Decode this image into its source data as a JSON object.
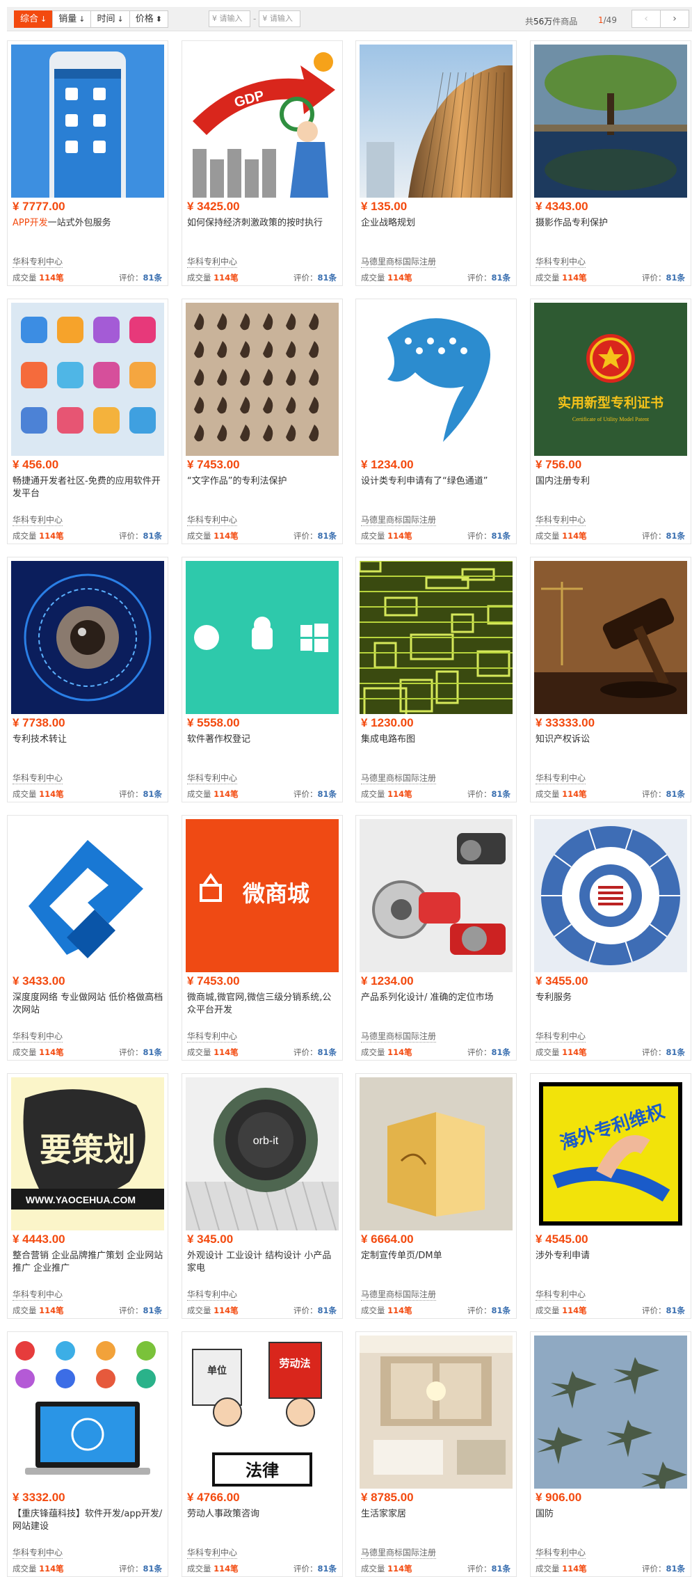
{
  "toolbar": {
    "sort": [
      {
        "label": "综合",
        "arrow": "↓",
        "active": true
      },
      {
        "label": "销量",
        "arrow": "↓",
        "active": false
      },
      {
        "label": "时间",
        "arrow": "↓",
        "active": false
      },
      {
        "label": "价格",
        "arrow": "⬍",
        "active": false
      }
    ],
    "price_min_placeholder": "¥ 请输入",
    "price_max_placeholder": "¥ 请输入",
    "price_dash": "-",
    "total_prefix": "共",
    "total_count": "56万",
    "total_suffix": "件商品",
    "page_current": "1",
    "page_total": "/49",
    "prev": "‹",
    "next": "›"
  },
  "products": [
    {
      "price": "¥ 7777.00",
      "title_hl": "APP开发",
      "title": "一站式外包服务",
      "shop": "华科专利中心",
      "sales_label": "成交量",
      "sales": "114笔",
      "reviews_label": "评价：",
      "reviews": "81条",
      "image": "app-phone"
    },
    {
      "price": "¥ 3425.00",
      "title_hl": "",
      "title": "如何保持经济刺激政策的按时执行",
      "shop": "华科专利中心",
      "sales_label": "成交量",
      "sales": "114笔",
      "reviews_label": "评价：",
      "reviews": "81条",
      "image": "gdp-cartoon"
    },
    {
      "price": "¥ 135.00",
      "title_hl": "",
      "title": "企业战略规划",
      "shop": "马德里商标国际注册",
      "sales_label": "成交量",
      "sales": "114笔",
      "reviews_label": "评价：",
      "reviews": "81条",
      "image": "building"
    },
    {
      "price": "¥ 4343.00",
      "title_hl": "",
      "title": "摄影作品专利保护",
      "shop": "华科专利中心",
      "sales_label": "成交量",
      "sales": "114笔",
      "reviews_label": "评价：",
      "reviews": "81条",
      "image": "tree"
    },
    {
      "price": "¥ 456.00",
      "title_hl": "",
      "title": "畅捷通开发者社区-免费的应用软件开发平台",
      "shop": "华科专利中心",
      "sales_label": "成交量",
      "sales": "114笔",
      "reviews_label": "评价：",
      "reviews": "81条",
      "image": "app-icons"
    },
    {
      "price": "¥ 7453.00",
      "title_hl": "",
      "title": "“文字作品”的专利法保护",
      "shop": "华科专利中心",
      "sales_label": "成交量",
      "sales": "114笔",
      "reviews_label": "评价：",
      "reviews": "81条",
      "image": "calligraphy"
    },
    {
      "price": "¥ 1234.00",
      "title_hl": "",
      "title": "设计类专利申请有了“绿色通道”",
      "shop": "马德里商标国际注册",
      "sales_label": "成交量",
      "sales": "114笔",
      "reviews_label": "评价：",
      "reviews": "81条",
      "image": "dolphin"
    },
    {
      "price": "¥ 756.00",
      "title_hl": "",
      "title": "国内注册专利",
      "shop": "华科专利中心",
      "sales_label": "成交量",
      "sales": "114笔",
      "reviews_label": "评价：",
      "reviews": "81条",
      "image": "certificate",
      "cert_title": "实用新型专利证书",
      "cert_sub": "Certificate of Utility Model Patent"
    },
    {
      "price": "¥ 7738.00",
      "title_hl": "",
      "title": "专利技术转让",
      "shop": "华科专利中心",
      "sales_label": "成交量",
      "sales": "114笔",
      "reviews_label": "评价：",
      "reviews": "81条",
      "image": "tech-eye"
    },
    {
      "price": "¥ 5558.00",
      "title_hl": "",
      "title": "软件著作权登记",
      "shop": "华科专利中心",
      "sales_label": "成交量",
      "sales": "114笔",
      "reviews_label": "评价：",
      "reviews": "81条",
      "image": "os-logos"
    },
    {
      "price": "¥ 1230.00",
      "title_hl": "",
      "title": "集成电路布图",
      "shop": "马德里商标国际注册",
      "sales_label": "成交量",
      "sales": "114笔",
      "reviews_label": "评价：",
      "reviews": "81条",
      "image": "circuit"
    },
    {
      "price": "¥ 33333.00",
      "title_hl": "",
      "title": "知识产权诉讼",
      "shop": "华科专利中心",
      "sales_label": "成交量",
      "sales": "114笔",
      "reviews_label": "评价：",
      "reviews": "81条",
      "image": "gavel"
    },
    {
      "price": "¥ 3433.00",
      "title_hl": "",
      "title": "深度度网络 专业做网站 低价格做高档次网站",
      "shop": "华科专利中心",
      "sales_label": "成交量",
      "sales": "114笔",
      "reviews_label": "评价：",
      "reviews": "81条",
      "image": "blue-logo"
    },
    {
      "price": "¥ 7453.00",
      "title_hl": "",
      "title": "微商城,微官网,微信三级分销系统,公众平台开发",
      "shop": "华科专利中心",
      "sales_label": "成交量",
      "sales": "114笔",
      "reviews_label": "评价：",
      "reviews": "81条",
      "image": "weishang",
      "weishang_text": "微商城"
    },
    {
      "price": "¥ 1234.00",
      "title_hl": "",
      "title": "产品系列化设计/ 准确的定位市场",
      "shop": "马德里商标国际注册",
      "sales_label": "成交量",
      "sales": "114笔",
      "reviews_label": "评价：",
      "reviews": "81条",
      "image": "tools"
    },
    {
      "price": "¥ 3455.00",
      "title_hl": "",
      "title": "专利服务",
      "shop": "华科专利中心",
      "sales_label": "成交量",
      "sales": "114笔",
      "reviews_label": "评价：",
      "reviews": "81条",
      "image": "circle-diagram"
    },
    {
      "price": "¥ 4443.00",
      "title_hl": "",
      "title": "整合营销 企业品牌推广策划 企业网站推广 企业推广",
      "shop": "华科专利中心",
      "sales_label": "成交量",
      "sales": "114笔",
      "reviews_label": "评价：",
      "reviews": "81条",
      "image": "yaocehua",
      "yaocehua_text": "WWW.YAOCEHUA.COM",
      "yaocehua_big": "要策划"
    },
    {
      "price": "¥ 345.00",
      "title_hl": "",
      "title": "外观设计 工业设计 结构设计 小产品家电",
      "shop": "华科专利中心",
      "sales_label": "成交量",
      "sales": "114笔",
      "reviews_label": "评价：",
      "reviews": "81条",
      "image": "orbit",
      "orbit_text": "orb-it"
    },
    {
      "price": "¥ 6664.00",
      "title_hl": "",
      "title": "定制宣传单页/DM单",
      "shop": "马德里商标国际注册",
      "sales_label": "成交量",
      "sales": "114笔",
      "reviews_label": "评价：",
      "reviews": "81条",
      "image": "brochure"
    },
    {
      "price": "¥ 4545.00",
      "title_hl": "",
      "title": "涉外专利申请",
      "shop": "华科专利中心",
      "sales_label": "成交量",
      "sales": "114笔",
      "reviews_label": "评价：",
      "reviews": "81条",
      "image": "overseas",
      "overseas_text": "海外专利维权"
    },
    {
      "price": "¥ 3332.00",
      "title_hl": "",
      "title": "【重庆锋蕴科技】软件开发/app开发/网站建设",
      "shop": "华科专利中心",
      "sales_label": "成交量",
      "sales": "114笔",
      "reviews_label": "评价：",
      "reviews": "81条",
      "image": "laptop-icons"
    },
    {
      "price": "¥ 4766.00",
      "title_hl": "",
      "title": "劳动人事政策咨询",
      "shop": "华科专利中心",
      "sales_label": "成交量",
      "sales": "114笔",
      "reviews_label": "评价：",
      "reviews": "81条",
      "image": "labor-law",
      "law_text": "法律",
      "law_top": "劳动法",
      "law_unit": "单位"
    },
    {
      "price": "¥ 8785.00",
      "title_hl": "",
      "title": "生活家家居",
      "shop": "马德里商标国际注册",
      "sales_label": "成交量",
      "sales": "114笔",
      "reviews_label": "评价：",
      "reviews": "81条",
      "image": "interior"
    },
    {
      "price": "¥ 906.00",
      "title_hl": "",
      "title": "国防",
      "shop": "华科专利中心",
      "sales_label": "成交量",
      "sales": "114笔",
      "reviews_label": "评价：",
      "reviews": "81条",
      "image": "jets"
    }
  ]
}
